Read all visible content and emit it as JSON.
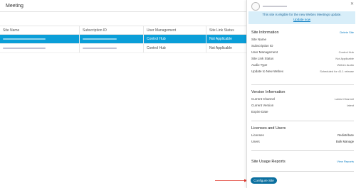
{
  "page": {
    "title": "Meeting"
  },
  "table": {
    "headers": [
      "Site Name",
      "Subscription ID",
      "User Management",
      "Site Link Status"
    ],
    "rows": [
      {
        "user_management": "Control Hub",
        "status": "Not Applicable"
      },
      {
        "user_management": "Control Hub",
        "status": "Not Applicable"
      }
    ]
  },
  "panel": {
    "banner_text": "This site is eligible for the new Webex Meetings update.",
    "banner_link": "Update now",
    "site_info": {
      "title": "Site Information",
      "action": "Delete Site",
      "rows": [
        {
          "label": "Site Name",
          "value": ""
        },
        {
          "label": "Subscription ID",
          "value": ""
        },
        {
          "label": "User Management",
          "value": "Control Hub"
        },
        {
          "label": "Site Link Status",
          "value": "Not Applicable"
        },
        {
          "label": "Audio Type",
          "value": "Webex Audio"
        },
        {
          "label": "Update to New Webex",
          "value": "Scheduled for 41.1 release"
        }
      ]
    },
    "version_info": {
      "title": "Version Information",
      "rows": [
        {
          "label": "Current Channel",
          "value": "Latest Channel"
        },
        {
          "label": "Current Version",
          "value": "latest"
        },
        {
          "label": "Expire Date",
          "value": ""
        }
      ]
    },
    "licenses": {
      "title": "Licenses and Users",
      "rows": [
        {
          "label": "Licenses",
          "value": "Redistribute"
        },
        {
          "label": "Users",
          "value": "Bulk Manage"
        }
      ]
    },
    "usage": {
      "title": "Site Usage Reports",
      "action": "View Reports"
    },
    "configure_button": "Configure Site",
    "close_icon": "close-icon",
    "accent_color": "#0b6f9f"
  }
}
